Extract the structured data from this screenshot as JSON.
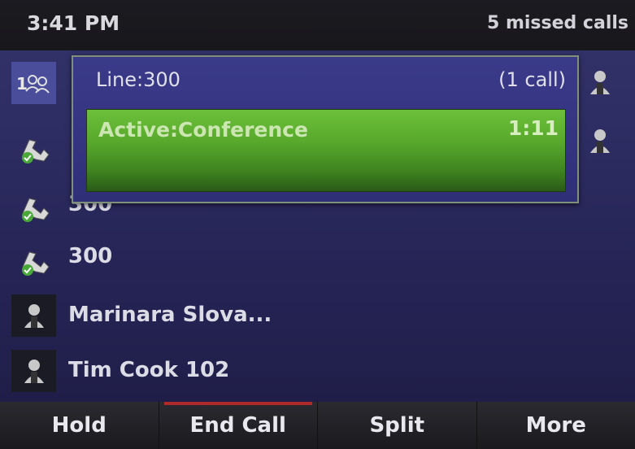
{
  "status_bar": {
    "time": "3:41 PM",
    "missed_calls": "5 missed calls"
  },
  "line_keys": [
    {
      "label": "",
      "icon": "conference-icon",
      "badge": "1"
    },
    {
      "label": "",
      "icon": "phone-handset-icon"
    },
    {
      "label": "300",
      "icon": "phone-handset-icon"
    },
    {
      "label": "300",
      "icon": "phone-handset-icon"
    },
    {
      "label": "Marinara Slova...",
      "icon": "contact-icon"
    },
    {
      "label": "Tim Cook 102",
      "icon": "contact-icon"
    }
  ],
  "popup": {
    "line": "Line:300",
    "calls": "(1 call)",
    "active_label": "Active:Conference",
    "active_time": "1:11"
  },
  "softkeys": [
    "Hold",
    "End Call",
    "Split",
    "More"
  ],
  "colors": {
    "accent_green": "#58a82c",
    "endcall_red": "#b02a2a",
    "background_blue": "#2d2d63"
  }
}
